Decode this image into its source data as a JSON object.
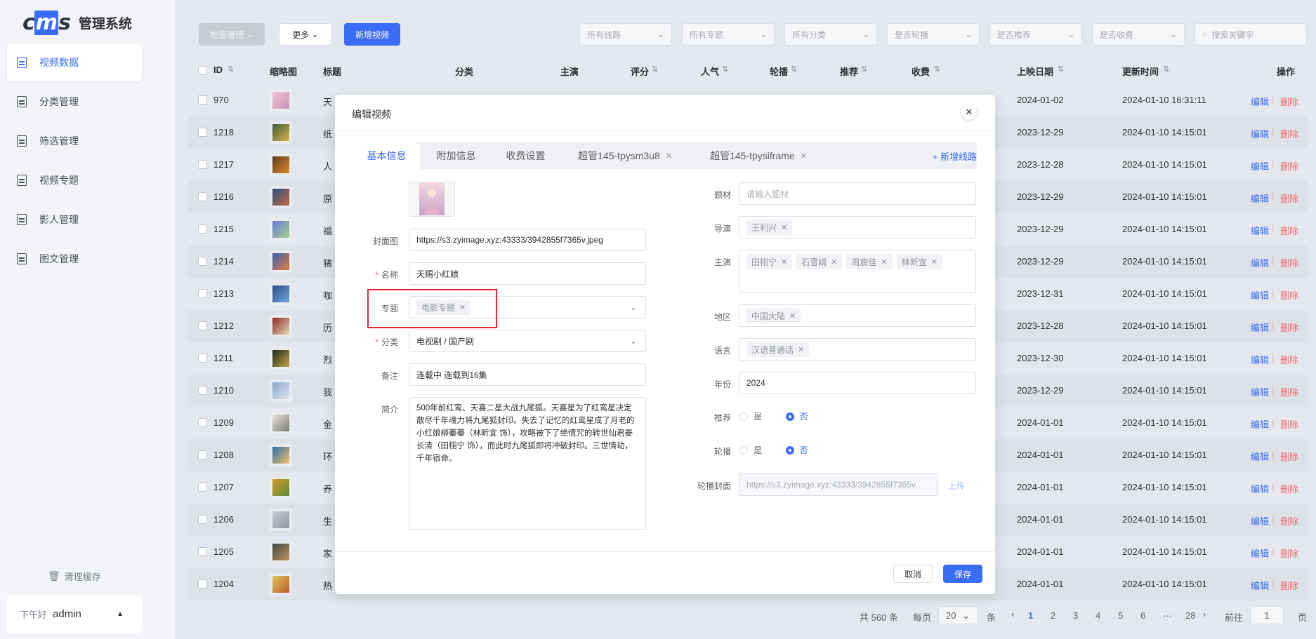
{
  "app": {
    "logo": "cms",
    "title": "管理系统"
  },
  "sidebar": {
    "items": [
      {
        "label": "视频数据",
        "active": true
      },
      {
        "label": "分类管理"
      },
      {
        "label": "筛选管理"
      },
      {
        "label": "视频专题"
      },
      {
        "label": "影人管理"
      },
      {
        "label": "图文管理"
      }
    ],
    "clear_cache": "清理缓存",
    "greeting": "下午好",
    "username": "admin"
  },
  "toolbar": {
    "batch": "批量管理",
    "more": "更多",
    "add_video": "新增视频",
    "filters": [
      "所有线路",
      "所有专题",
      "所有分类",
      "是否轮播",
      "是否推荐",
      "是否收费"
    ],
    "search_placeholder": "搜索关键字"
  },
  "table": {
    "headers": [
      "ID",
      "缩略图",
      "标题",
      "分类",
      "主演",
      "评分",
      "人气",
      "轮播",
      "推荐",
      "收费",
      "上映日期",
      "更新时间",
      "操作"
    ],
    "rows": [
      {
        "id": "970",
        "title": "天",
        "date": "2024-01-02",
        "updated": "2024-01-10 16:31:11"
      },
      {
        "id": "1218",
        "title": "纸",
        "date": "2023-12-29",
        "updated": "2024-01-10 14:15:01"
      },
      {
        "id": "1217",
        "title": "人",
        "date": "2023-12-28",
        "updated": "2024-01-10 14:15:01"
      },
      {
        "id": "1216",
        "title": "原",
        "date": "2023-12-29",
        "updated": "2024-01-10 14:15:01"
      },
      {
        "id": "1215",
        "title": "福",
        "date": "2023-12-29",
        "updated": "2024-01-10 14:15:01"
      },
      {
        "id": "1214",
        "title": "猪",
        "date": "2023-12-29",
        "updated": "2024-01-10 14:15:01"
      },
      {
        "id": "1213",
        "title": "咖",
        "date": "2023-12-31",
        "updated": "2024-01-10 14:15:01"
      },
      {
        "id": "1212",
        "title": "历",
        "date": "2023-12-28",
        "updated": "2024-01-10 14:15:01"
      },
      {
        "id": "1211",
        "title": "烈",
        "date": "2023-12-30",
        "updated": "2024-01-10 14:15:01"
      },
      {
        "id": "1210",
        "title": "我",
        "date": "2023-12-29",
        "updated": "2024-01-10 14:15:01"
      },
      {
        "id": "1209",
        "title": "金",
        "date": "2024-01-01",
        "updated": "2024-01-10 14:15:01"
      },
      {
        "id": "1208",
        "title": "环",
        "date": "2024-01-01",
        "updated": "2024-01-10 14:15:01"
      },
      {
        "id": "1207",
        "title": "养",
        "date": "2024-01-01",
        "updated": "2024-01-10 14:15:01"
      },
      {
        "id": "1206",
        "title": "生",
        "date": "2024-01-01",
        "updated": "2024-01-10 14:15:01"
      },
      {
        "id": "1205",
        "title": "家",
        "date": "2024-01-01",
        "updated": "2024-01-10 14:15:01"
      },
      {
        "id": "1204",
        "title": "热",
        "date": "2024-01-01",
        "updated": "2024-01-10 14:15:01"
      }
    ],
    "edit": "编辑",
    "delete": "删除"
  },
  "pager": {
    "total": "共 560 条",
    "per": "每页",
    "size": "20",
    "unit": "条",
    "pages": [
      "1",
      "2",
      "3",
      "4",
      "5",
      "6",
      "···",
      "28"
    ],
    "goto": "前往",
    "goto_val": "1",
    "page_word": "页"
  },
  "dialog": {
    "title": "编辑视频",
    "tabs": [
      "基本信息",
      "附加信息",
      "收费设置",
      "超管145-tpysm3u8",
      "超管145-tpysiframe"
    ],
    "add_route": "+ 新增线路",
    "labels": {
      "cover": "封面图",
      "name": "名称",
      "topic": "专题",
      "category": "分类",
      "remark": "备注",
      "intro": "简介",
      "theme": "题材",
      "director": "导演",
      "actors": "主演",
      "region": "地区",
      "language": "语言",
      "year": "年份",
      "recommend": "推荐",
      "carousel": "轮播",
      "carousel_cover": "轮播封面"
    },
    "cover_url": "https://s3.zyimage.xyz:43333/3942855f7365v.jpeg",
    "name": "天赐小红娘",
    "topic_tag": "电影专题",
    "category": "电视剧 / 国产剧",
    "remark": "连載中 连载到16集",
    "intro": "500年前红鸾、天喜二星大战九尾狐。天喜星为了红鸾星决定散尽千年魂力将九尾狐封印。失去了记忆的红鸾星成了月老的小红娘柳蓁蓁（林昕宜 饰），攻略被下了绝情咒的转世仙君姜长清（田栩宁 饰），而此时九尾狐即将冲破封印。三世情劫，千年宿命。",
    "theme_placeholder": "请输入题材",
    "director_tags": [
      "王利兴"
    ],
    "actor_tags": [
      "田栩宁",
      "石雪婧",
      "周宸佳",
      "林昕宜"
    ],
    "region_tags": [
      "中国大陆"
    ],
    "language_tags": [
      "汉语普通话"
    ],
    "year": "2024",
    "yes": "是",
    "no": "否",
    "carousel_cover_url": "https://s3.zyimage.xyz:43333/3942855f7365v.",
    "upload": "上传",
    "cancel": "取消",
    "save": "保存"
  }
}
